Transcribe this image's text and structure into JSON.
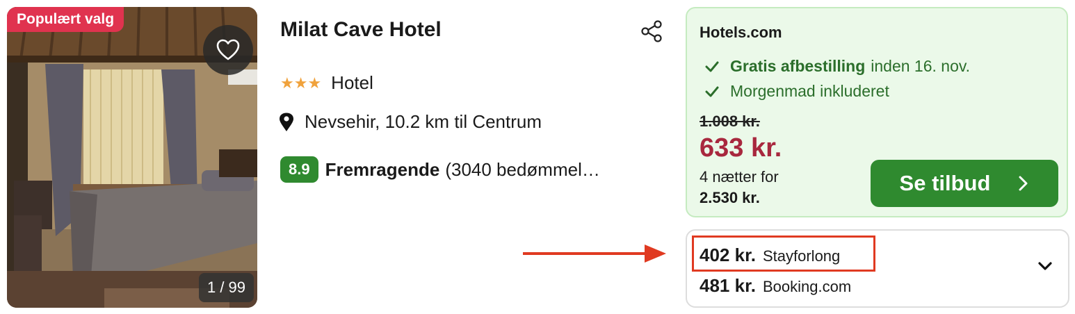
{
  "photo": {
    "badge": "Populært valg",
    "counter": "1 / 99"
  },
  "hotel": {
    "name": "Milat Cave Hotel",
    "stars": "★★★",
    "type": "Hotel",
    "location": "Nevsehir, 10.2 km til Centrum",
    "score": "8.9",
    "rating_word": "Fremragende",
    "reviews": "(3040 bedømmel…"
  },
  "deal": {
    "provider": "Hotels.com",
    "perks": [
      {
        "bold": "Gratis afbestilling",
        "text": "inden 16. nov."
      },
      {
        "bold": "",
        "text": "Morgenmad inkluderet"
      }
    ],
    "old_price": "1.008 kr.",
    "price": "633 kr.",
    "nights_label": "4 nætter for",
    "total": "2.530 kr.",
    "cta": "Se tilbud"
  },
  "other_offers": [
    {
      "price": "402 kr.",
      "provider": "Stayforlong"
    },
    {
      "price": "481 kr.",
      "provider": "Booking.com"
    }
  ],
  "colors": {
    "badge": "#e0334f",
    "price_red": "#a8283e",
    "green": "#2f8a2f",
    "deal_bg": "#ebf9e9",
    "stars": "#f0a23c",
    "annotation": "#e03a21"
  }
}
